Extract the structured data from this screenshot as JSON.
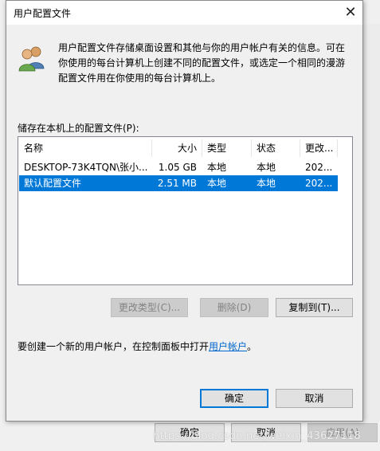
{
  "background": {
    "buttons": {
      "ok": "确定",
      "cancel": "取消",
      "apply": "应用(A)"
    },
    "watermark": "https://blog.csdn.net/weixin_43627118"
  },
  "dialog": {
    "title": "用户配置文件",
    "close_icon": "close-icon",
    "icon": "users-icon",
    "description": [
      "用户配置文件存储桌面设置和其他与你的用户帐户有关的信息。可在",
      "你使用的每台计算机上创建不同的配置文件，或选定一个相同的漫游",
      "配置文件用在你使用的每台计算机上。"
    ],
    "list_label": "储存在本机上的配置文件(P):",
    "columns": [
      "名称",
      "大小",
      "类型",
      "状态",
      "更改..."
    ],
    "rows": [
      {
        "name": "DESKTOP-73K4TQN\\张小...",
        "size": "1.05 GB",
        "type": "本地",
        "status": "本地",
        "changed": "202...",
        "selected": false
      },
      {
        "name": "默认配置文件",
        "size": "2.51 MB",
        "type": "本地",
        "status": "本地",
        "changed": "202...",
        "selected": true
      }
    ],
    "buttons": {
      "change_type": "更改类型(C)...",
      "delete": "删除(D)",
      "copy_to": "复制到(T)...",
      "ok": "确定",
      "cancel": "取消"
    },
    "create_text": "要创建一个新的用户帐户，在控制面板中打开",
    "create_link": "用户帐户",
    "create_suffix": "。",
    "selection_color": "#0078d7",
    "link_color": "#0066cc"
  }
}
